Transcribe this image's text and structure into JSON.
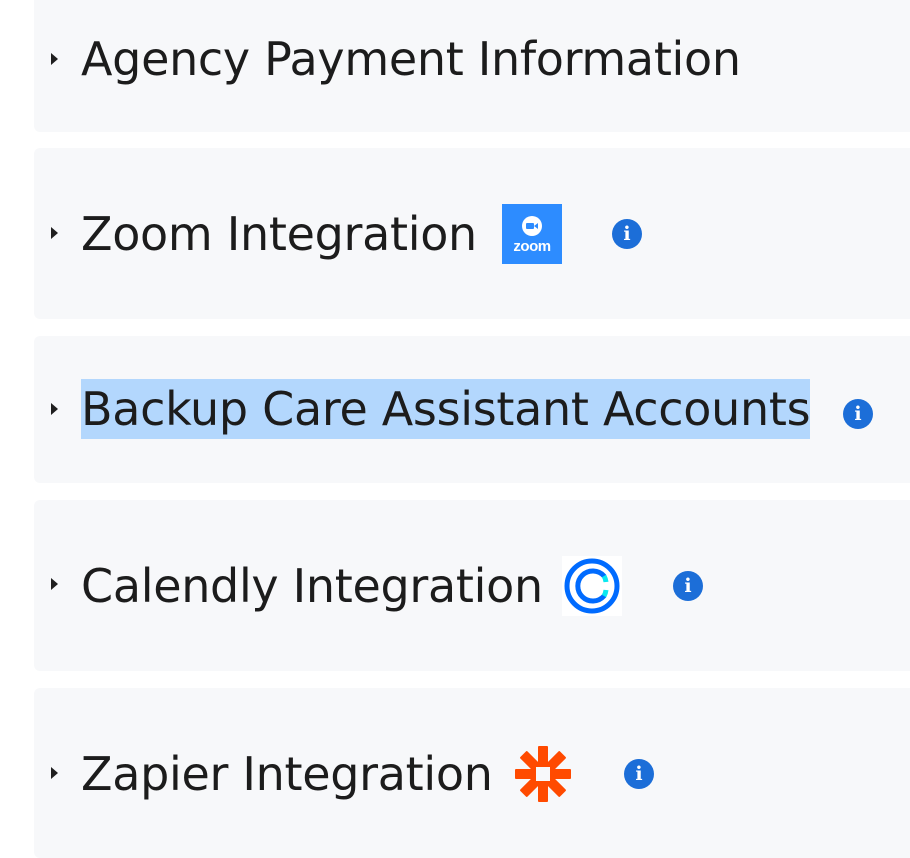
{
  "sections": [
    {
      "title": "Agency Payment Information"
    },
    {
      "title": "Zoom Integration",
      "logo": "zoom-logo",
      "logo_text": "zoom",
      "info": "i"
    },
    {
      "title": "Backup Care Assistant Accounts",
      "info": "i",
      "selected": true
    },
    {
      "title": "Calendly Integration",
      "logo": "calendly-logo",
      "info": "i"
    },
    {
      "title": "Zapier Integration",
      "logo": "zapier-logo",
      "info": "i"
    }
  ],
  "colors": {
    "panel_bg": "#f7f8fa",
    "info_icon": "#1c6ed8",
    "selection": "#b3d7fd",
    "zoom_brand": "#2d8cff",
    "calendly_brand": "#006bff",
    "zapier_brand": "#ff4a00"
  }
}
